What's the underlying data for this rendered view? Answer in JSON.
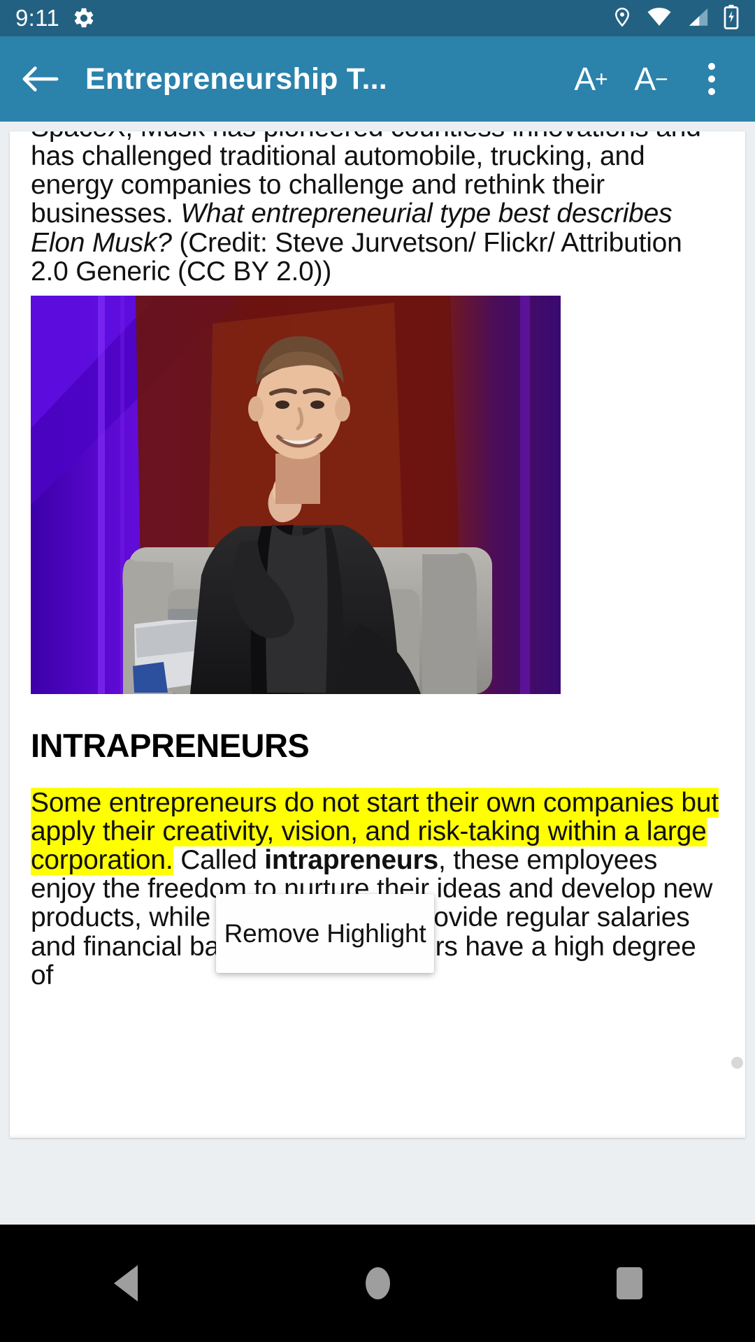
{
  "status_bar": {
    "time": "9:11",
    "icons": [
      "gear-icon",
      "location-pin-icon",
      "wifi-icon",
      "cellular-signal-icon",
      "battery-charging-icon"
    ],
    "background_color": "#236182"
  },
  "app_bar": {
    "back_label": "←",
    "title": "Entrepreneurship T...",
    "increase_font_label": "A",
    "increase_font_sup": "+",
    "decrease_font_label": "A",
    "decrease_font_sup": "−",
    "overflow_label": "More options",
    "background_color": "#2b82ab"
  },
  "content": {
    "paragraph_top_parts": [
      {
        "text": "SpaceX, Musk has pioneered countless innovations and has challenged traditional automobile, trucking, and energy companies to challenge and rethink their businesses. ",
        "style": "normal"
      },
      {
        "text": "What entrepreneurial type best describes Elon Musk?",
        "style": "italic"
      },
      {
        "text": " (Credit: Steve Jurvetson/ Flickr/ Attribution 2.0 Generic (CC BY 2.0))",
        "style": "normal"
      }
    ],
    "figure_alt": "Elon Musk seated in an armchair on a stage with purple and red backdrop",
    "heading": "INTRAPRENEURS",
    "paragraph_body_parts": [
      {
        "text": "Some entrepreneurs do not start their own companies but apply their creativity, vision, and risk-taking within a large corporation.",
        "style": "highlight"
      },
      {
        "text": " Called ",
        "style": "normal"
      },
      {
        "text": "intrapreneurs",
        "style": "bold"
      },
      {
        "text": ", these employees enjoy the freedom to nurture their ideas and develop new products, while their employers provide regular salaries and financial backing. Intrapreneurs have a high degree of",
        "style": "normal"
      }
    ],
    "highlight_color": "#ffff00"
  },
  "popup": {
    "label": "Remove Highlight"
  },
  "nav_bar": {
    "back_label": "Back",
    "home_label": "Home",
    "recents_label": "Recents"
  }
}
